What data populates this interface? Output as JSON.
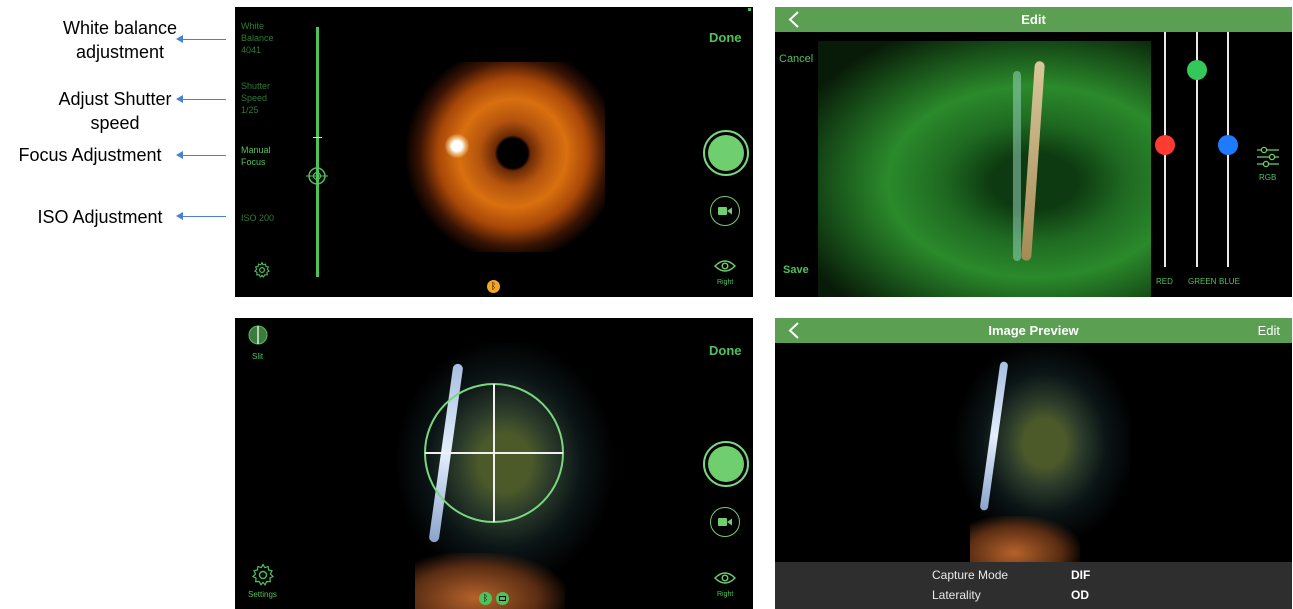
{
  "annotations": [
    {
      "id": "wb",
      "text": "White balance\nadjustment"
    },
    {
      "id": "shutter",
      "text": "Adjust Shutter\nspeed"
    },
    {
      "id": "focus",
      "text": "Focus Adjustment"
    },
    {
      "id": "iso",
      "text": "ISO Adjustment"
    }
  ],
  "panel1": {
    "white_balance_label": "White\nBalance\n4041",
    "shutter_label": "Shutter\nSpeed\n1/25",
    "focus_label": "Manual\nFocus",
    "iso_label": "ISO 200",
    "done": "Done",
    "eye": "Right"
  },
  "panel2": {
    "title": "Edit",
    "cancel": "Cancel",
    "save": "Save",
    "rgb": "RGB",
    "channels": [
      {
        "name": "RED",
        "value": 0.52,
        "color": "#ff3b30"
      },
      {
        "name": "GREEN",
        "value": 0.84,
        "color": "#34c759"
      },
      {
        "name": "BLUE",
        "value": 0.52,
        "color": "#1e7bff"
      }
    ]
  },
  "panel3": {
    "slit": "Slit",
    "done": "Done",
    "settings": "Settings",
    "eye": "Right"
  },
  "panel4": {
    "title": "Image Preview",
    "edit": "Edit",
    "info": [
      {
        "label": "Capture Mode",
        "value": "DIF"
      },
      {
        "label": "Laterality",
        "value": "OD"
      }
    ]
  },
  "colors": {
    "accent": "#4fc25b",
    "header": "#5a9f52"
  }
}
